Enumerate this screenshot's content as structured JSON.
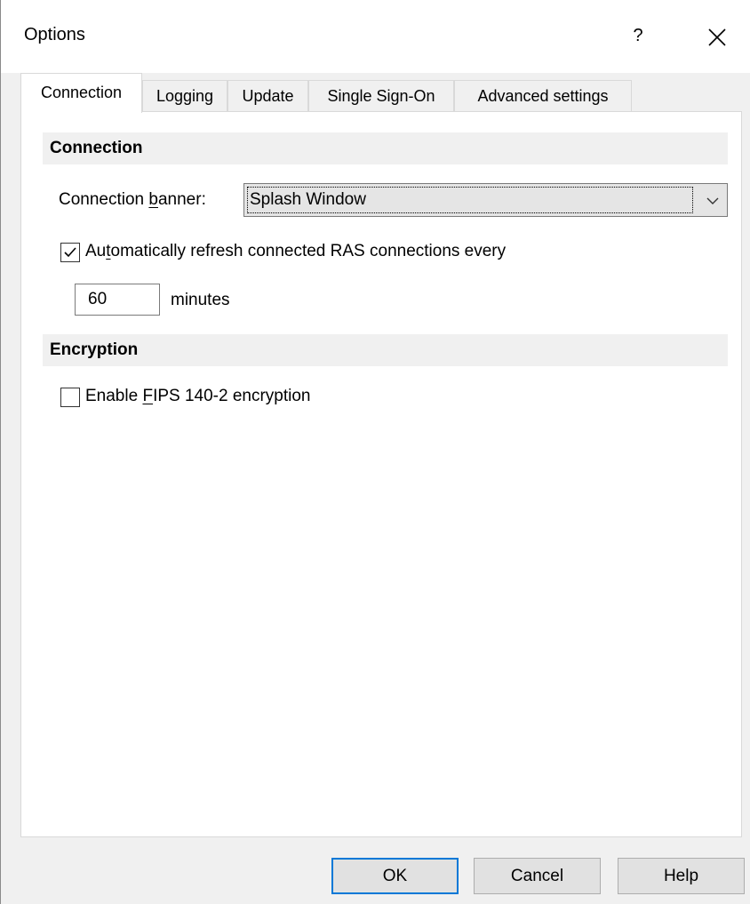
{
  "window": {
    "title": "Options",
    "help_glyph": "?",
    "close_icon": "close-icon"
  },
  "tabs": [
    {
      "label": "Connection",
      "active": true
    },
    {
      "label": "Logging",
      "active": false
    },
    {
      "label": "Update",
      "active": false
    },
    {
      "label": "Single Sign-On",
      "active": false
    },
    {
      "label": "Advanced settings",
      "active": false
    }
  ],
  "connection_section": {
    "header": "Connection",
    "banner_label_pre": "Connection ",
    "banner_label_underlined": "b",
    "banner_label_post": "anner:",
    "banner_value": "Splash Window",
    "auto_refresh": {
      "checked": true,
      "label_pre": "Au",
      "label_underlined": "t",
      "label_post": "omatically refresh connected RAS connections every"
    },
    "refresh_minutes_value": "60",
    "minutes_label": "minutes"
  },
  "encryption_section": {
    "header": "Encryption",
    "fips": {
      "checked": false,
      "label_pre": "Enable ",
      "label_underlined": "F",
      "label_post": "IPS 140-2 encryption"
    }
  },
  "buttons": {
    "ok": "OK",
    "cancel": "Cancel",
    "help": "Help"
  },
  "colors": {
    "accent": "#0078d7",
    "section_bg": "#f0f0f0",
    "panel_bg": "#ffffff"
  }
}
